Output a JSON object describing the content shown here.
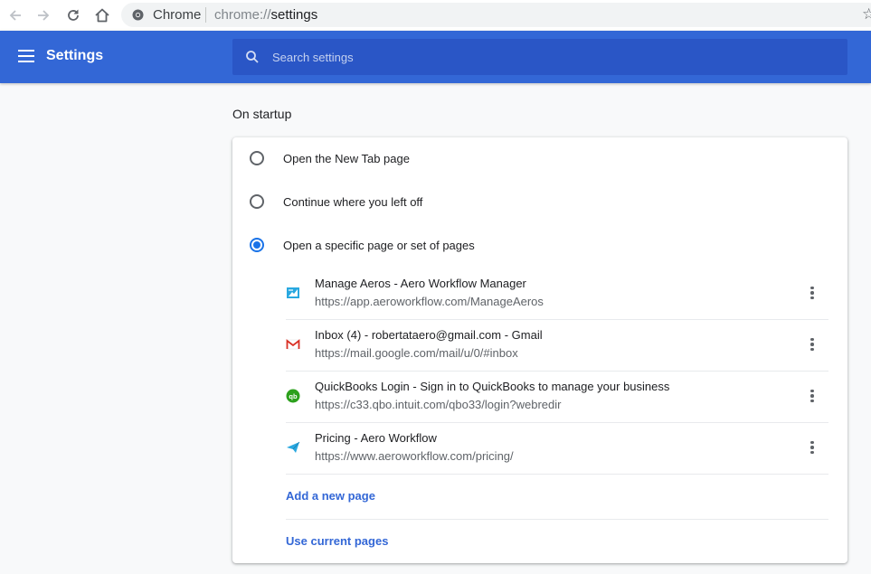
{
  "browser": {
    "site_name": "Chrome",
    "url_scheme": "chrome://",
    "url_host": "settings",
    "bookmark_icon": "☆"
  },
  "header": {
    "title": "Settings",
    "search_placeholder": "Search settings",
    "background_color": "#3367d6"
  },
  "section": {
    "title": "On startup"
  },
  "startup_options": [
    {
      "label": "Open the New Tab page",
      "checked": false
    },
    {
      "label": "Continue where you left off",
      "checked": false
    },
    {
      "label": "Open a specific page or set of pages",
      "checked": true
    }
  ],
  "pages": [
    {
      "title": "Manage Aeros - Aero Workflow Manager",
      "url": "https://app.aeroworkflow.com/ManageAeros",
      "icon": "aero-workflow-icon"
    },
    {
      "title": "Inbox (4) - robertataero@gmail.com - Gmail",
      "url": "https://mail.google.com/mail/u/0/#inbox",
      "icon": "gmail-icon"
    },
    {
      "title": "QuickBooks Login - Sign in to QuickBooks to manage your business",
      "url": "https://c33.qbo.intuit.com/qbo33/login?webredir",
      "icon": "quickbooks-icon"
    },
    {
      "title": "Pricing - Aero Workflow",
      "url": "https://www.aeroworkflow.com/pricing/",
      "icon": "paper-plane-icon"
    }
  ],
  "actions": {
    "add_page": "Add a new page",
    "use_current": "Use current pages"
  },
  "colors": {
    "accent": "#1a73e8",
    "link": "#3367d6"
  }
}
